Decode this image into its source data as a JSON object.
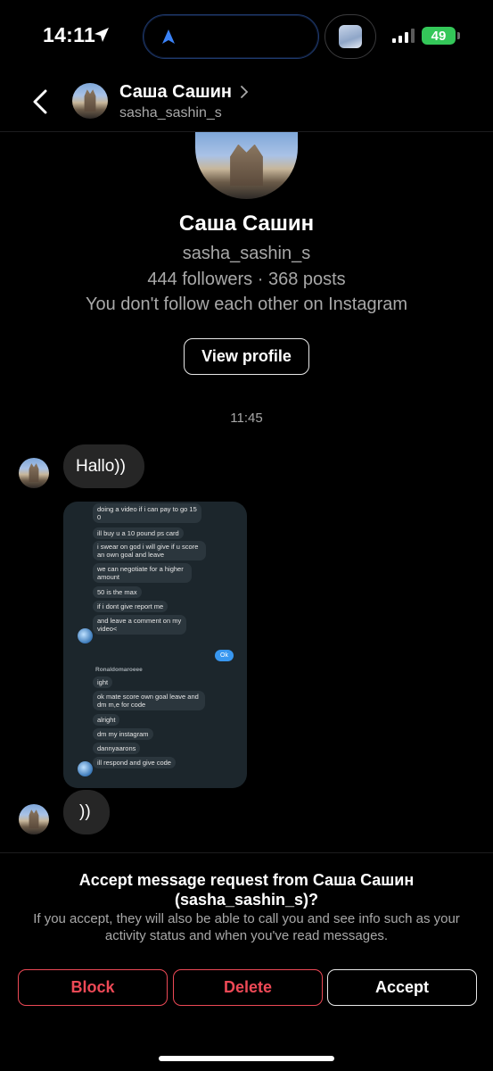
{
  "status_bar": {
    "time": "14:11",
    "battery": "49"
  },
  "header": {
    "name": "Саша Сашин",
    "username": "sasha_sashin_s"
  },
  "profile": {
    "name": "Саша Сашин",
    "username": "sasha_sashin_s",
    "stats": "444 followers · 368 posts",
    "follow_status": "You don't follow each other on Instagram",
    "view_profile_label": "View profile"
  },
  "chat": {
    "timestamp": "11:45",
    "messages": [
      "Hallo))",
      "))"
    ],
    "screenshot": {
      "bubbles": [
        "doing a video if i can pay to go 15 0",
        "ill buy u a 10 pound ps card",
        "i swear on god i will give if u score an own goal and leave",
        "we can negotiate for a higher amount",
        "50 is the max",
        "if i dont give report me",
        "and leave a comment on my video<",
        "ight",
        "ok mate score own goal leave and dm m,e for code",
        "alright",
        "dm my instagram",
        "dannyaarons",
        "ill respond and give code"
      ],
      "ok": "Ok",
      "sender": "Ronaldomaroeee"
    }
  },
  "request": {
    "title": "Accept message request from Саша Сашин (sasha_sashin_s)?",
    "description": "If you accept, they will also be able to call you and see info such as your activity status and when you've read messages.",
    "block_label": "Block",
    "delete_label": "Delete",
    "accept_label": "Accept"
  },
  "colors": {
    "danger": "#ed4956",
    "battery": "#34c759",
    "bubble": "#262626",
    "muted": "#a8a8a8"
  }
}
